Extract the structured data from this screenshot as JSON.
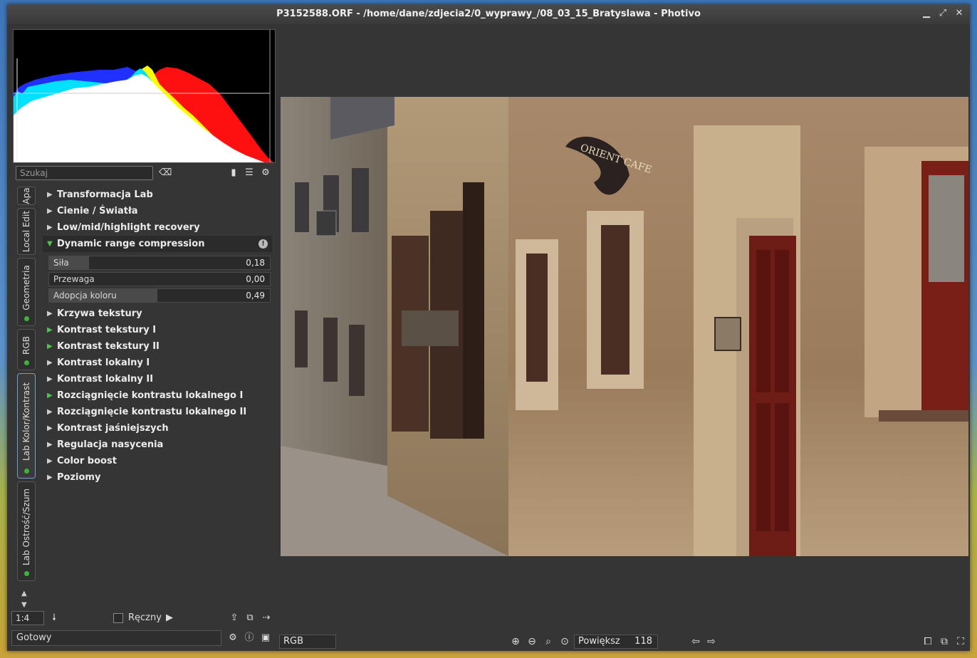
{
  "window": {
    "title": "P3152588.ORF - /home/dane/zdjecia2/0_wyprawy_/08_03_15_Bratyslawa - Photivo",
    "controls": [
      "minimize-icon",
      "maximize-icon",
      "close-icon"
    ]
  },
  "search": {
    "placeholder": "Szukaj"
  },
  "tabs": [
    {
      "label": "Apa",
      "active": false,
      "enabled_dot": false
    },
    {
      "label": "Local Edit",
      "active": false,
      "enabled_dot": false
    },
    {
      "label": "Geometria",
      "active": false,
      "enabled_dot": true
    },
    {
      "label": "RGB",
      "active": false,
      "enabled_dot": true
    },
    {
      "label": "Lab Kolor/Kontrast",
      "active": true,
      "enabled_dot": true
    },
    {
      "label": "Lab Ostrość/Szum",
      "active": false,
      "enabled_dot": true
    }
  ],
  "modules": [
    {
      "label": "Transformacja Lab",
      "active": false
    },
    {
      "label": "Cienie / Światła",
      "active": false
    },
    {
      "label": "Low/mid/highlight recovery",
      "active": false
    },
    {
      "label": "Dynamic range compression",
      "active": true,
      "expanded": true
    },
    {
      "label": "Krzywa tekstury",
      "active": false
    },
    {
      "label": "Kontrast tekstury I",
      "active": true
    },
    {
      "label": "Kontrast tekstury II",
      "active": true
    },
    {
      "label": "Kontrast lokalny I",
      "active": false
    },
    {
      "label": "Kontrast lokalny II",
      "active": false
    },
    {
      "label": "Rozciągnięcie kontrastu lokalnego I",
      "active": true
    },
    {
      "label": "Rozciągnięcie kontrastu lokalnego II",
      "active": false
    },
    {
      "label": "Kontrast jaśniejszych",
      "active": false
    },
    {
      "label": "Regulacja nasycenia",
      "active": false
    },
    {
      "label": "Color boost",
      "active": false
    },
    {
      "label": "Poziomy",
      "active": false
    }
  ],
  "sliders": [
    {
      "label": "Siła",
      "value": "0,18",
      "fraction": 0.18
    },
    {
      "label": "Przewaga",
      "value": "0,00",
      "fraction": 0.0
    },
    {
      "label": "Adopcja koloru",
      "value": "0,49",
      "fraction": 0.49
    }
  ],
  "bottom_left": {
    "scale": "1:4",
    "manual_label": "Ręczny",
    "manual_checked": false,
    "status": "Gotowy"
  },
  "viewer_bar": {
    "channel": "RGB",
    "zoom_label": "Powiększ",
    "zoom_value": "118"
  },
  "photo": {
    "sign_text": "ORIENT CAFE"
  },
  "colors": {
    "accent": "#6fa0cc",
    "active_dot": "#3db33d",
    "active_triangle": "#4ec44e",
    "background": "#353535"
  }
}
